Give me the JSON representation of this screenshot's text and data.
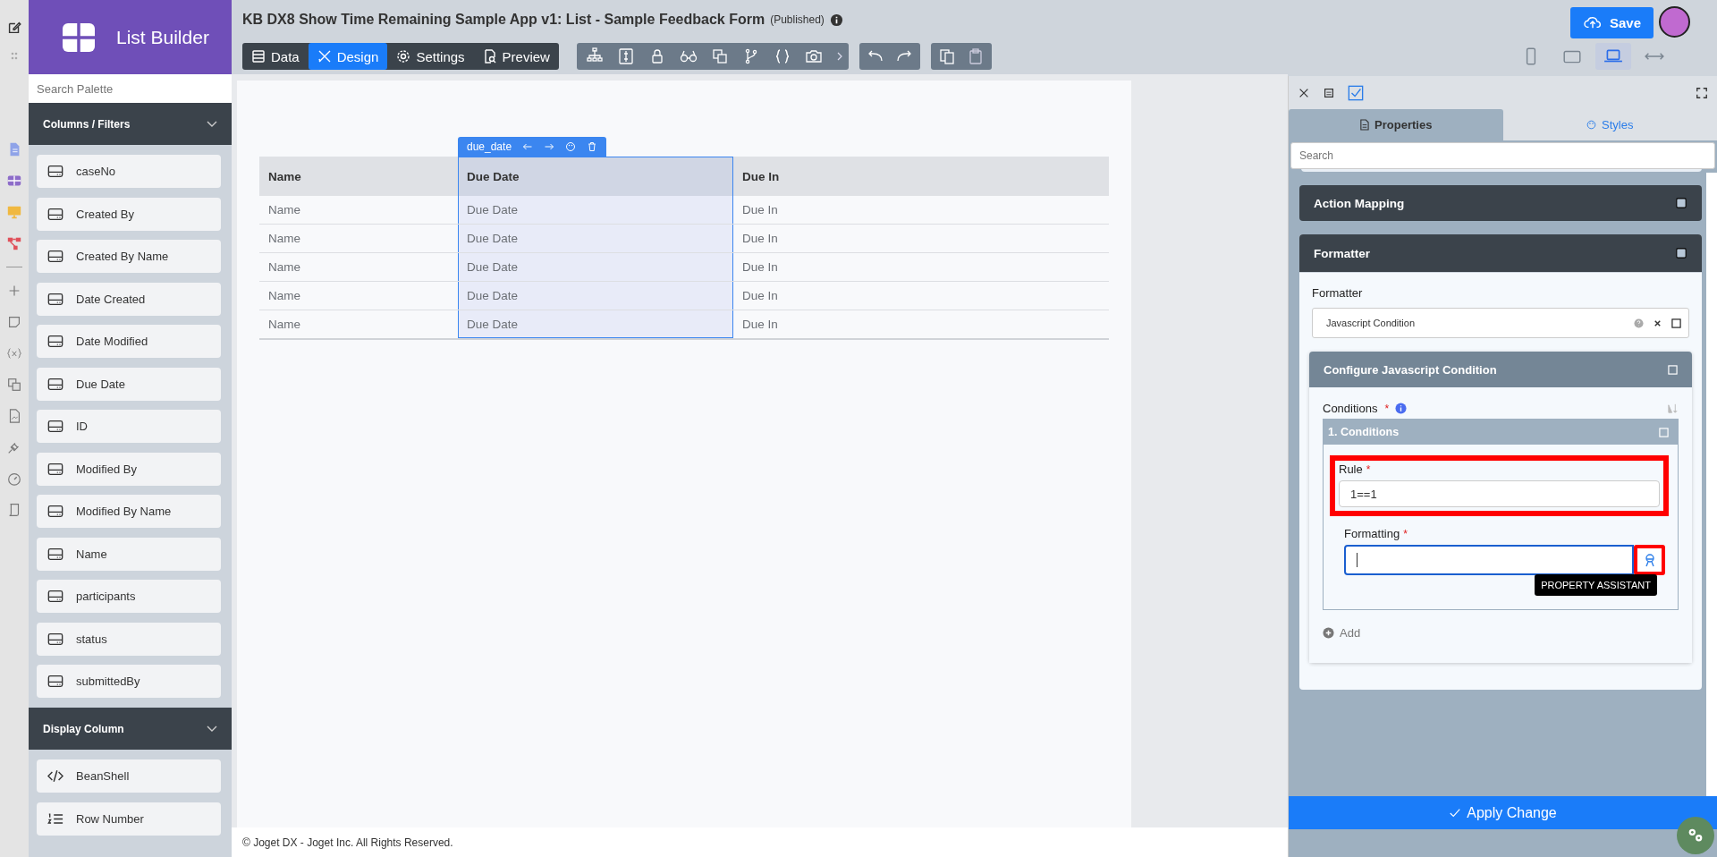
{
  "app": {
    "name": "List Builder"
  },
  "header": {
    "title": "KB DX8 Show Time Remaining Sample App v1: List - Sample Feedback Form",
    "status": "(Published)",
    "modes": [
      {
        "label": "Data",
        "kind": "data",
        "selected": false
      },
      {
        "label": "Design",
        "kind": "design",
        "selected": true
      },
      {
        "label": "Settings",
        "kind": "settings",
        "selected": false
      },
      {
        "label": "Preview",
        "kind": "preview",
        "selected": false
      }
    ],
    "save_label": "Save",
    "viewports": [
      {
        "kind": "phone",
        "selected": false
      },
      {
        "kind": "tablet",
        "selected": false
      },
      {
        "kind": "laptop",
        "selected": true
      },
      {
        "kind": "full-width",
        "selected": false
      }
    ]
  },
  "palette": {
    "search_placeholder": "Search Palette",
    "sections": [
      {
        "title": "Columns / Filters",
        "expanded": true,
        "items": [
          {
            "label": "caseNo",
            "kind": "column"
          },
          {
            "label": "Created By",
            "kind": "column"
          },
          {
            "label": "Created By Name",
            "kind": "column"
          },
          {
            "label": "Date Created",
            "kind": "column"
          },
          {
            "label": "Date Modified",
            "kind": "column"
          },
          {
            "label": "Due Date",
            "kind": "column"
          },
          {
            "label": "ID",
            "kind": "column"
          },
          {
            "label": "Modified By",
            "kind": "column"
          },
          {
            "label": "Modified By Name",
            "kind": "column"
          },
          {
            "label": "Name",
            "kind": "column"
          },
          {
            "label": "participants",
            "kind": "column"
          },
          {
            "label": "status",
            "kind": "column"
          },
          {
            "label": "submittedBy",
            "kind": "column"
          }
        ]
      },
      {
        "title": "Display Column",
        "expanded": true,
        "items": [
          {
            "label": "BeanShell",
            "kind": "code"
          },
          {
            "label": "Row Number",
            "kind": "numbered"
          }
        ]
      }
    ]
  },
  "canvas": {
    "column_toolbar": "due_date",
    "table": {
      "columns": [
        {
          "label": "Name",
          "selected": false
        },
        {
          "label": "Due Date",
          "selected": true
        },
        {
          "label": "Due In",
          "selected": false
        }
      ],
      "rows": [
        [
          "Name",
          "Due Date",
          "Due In"
        ],
        [
          "Name",
          "Due Date",
          "Due In"
        ],
        [
          "Name",
          "Due Date",
          "Due In"
        ],
        [
          "Name",
          "Due Date",
          "Due In"
        ],
        [
          "Name",
          "Due Date",
          "Due In"
        ]
      ]
    },
    "footer": "© Joget DX - Joget Inc. All Rights Reserved."
  },
  "properties": {
    "tabs": [
      {
        "label": "Properties",
        "kind": "properties",
        "selected": true
      },
      {
        "label": "Styles",
        "kind": "styles",
        "selected": false
      }
    ],
    "search_placeholder": "Search",
    "sections": [
      {
        "title": "Action Mapping",
        "expanded": false
      },
      {
        "title": "Formatter",
        "expanded": true
      }
    ],
    "formatter": {
      "label": "Formatter",
      "value": "Javascript Condition",
      "config": {
        "title": "Configure Javascript Condition",
        "conditions_label": "Conditions",
        "required_mark": "*",
        "item_title": "1. Conditions",
        "rule": {
          "label": "Rule",
          "required_mark": "*",
          "value": "1==1",
          "highlighted": true
        },
        "formatting": {
          "label": "Formatting",
          "required_mark": "*",
          "focused": true,
          "assistant_highlighted": true
        },
        "tooltip": "PROPERTY ASSISTANT",
        "add_label": "Add"
      }
    },
    "apply_label": "Apply Change"
  }
}
